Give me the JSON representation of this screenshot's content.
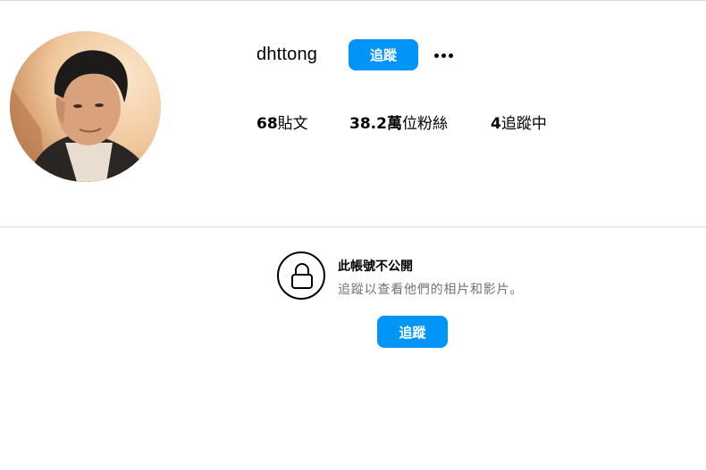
{
  "profile": {
    "username": "dhttong",
    "follow_label": "追蹤",
    "more_icon": "more-horizontal-icon",
    "stats": {
      "posts_count": "68",
      "posts_label": "貼文",
      "followers_count": "38.2萬",
      "followers_label": "位粉絲",
      "following_count": "4",
      "following_label": "追蹤中"
    }
  },
  "private_notice": {
    "icon": "lock-icon",
    "title": "此帳號不公開",
    "subtitle": "追蹤以查看他們的相片和影片。",
    "follow_label": "追蹤"
  },
  "colors": {
    "accent": "#0095f6",
    "divider": "#dbdbdb",
    "secondary_text": "#737373"
  }
}
